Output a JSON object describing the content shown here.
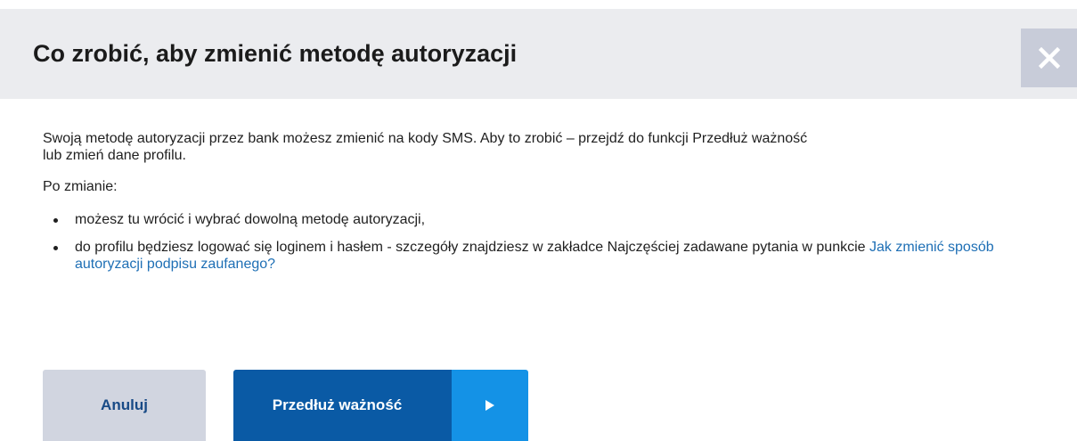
{
  "dialog": {
    "title": "Co zrobić, aby zmienić metodę autoryzacji",
    "close_icon": "close-icon",
    "intro": "Swoją metodę autoryzacji przez bank możesz zmienić na kody SMS. Aby to zrobić – przejdź do funkcji Przedłuż ważność lub zmień dane profilu.",
    "after_change_label": "Po zmianie:",
    "bullets": [
      {
        "text": "możesz tu wrócić i wybrać dowolną metodę autoryzacji,"
      },
      {
        "text": "do profilu będziesz logować się loginem i hasłem - szczegóły znajdziesz w zakładce Najczęściej zadawane pytania w punkcie ",
        "link": "Jak zmienić sposób autoryzacji podpisu zaufanego?"
      }
    ]
  },
  "buttons": {
    "cancel_label": "Anuluj",
    "primary_label": "Przedłuż ważność",
    "primary_icon": "play-arrow-icon"
  },
  "colors": {
    "header_bg": "#ebecef",
    "close_bg": "#c8ccd9",
    "link": "#1e6fb5",
    "primary": "#0a5aa5",
    "primary_arrow": "#1492e6",
    "cancel_bg": "#d1d5e0",
    "cancel_text": "#184a86"
  }
}
